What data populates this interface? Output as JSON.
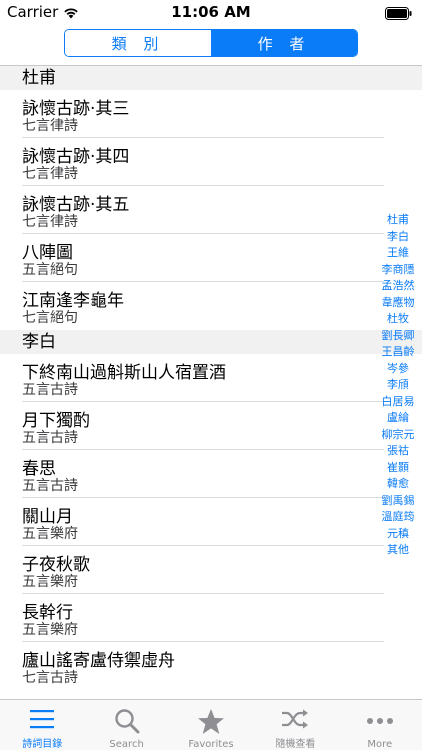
{
  "status": {
    "carrier": "Carrier",
    "time": "11:06 AM"
  },
  "segmented": {
    "left": "類 別",
    "right": "作 者",
    "selected": "right"
  },
  "sections": [
    {
      "header": "杜甫",
      "rows": [
        {
          "title": "詠懷古跡·其三",
          "subtitle": "七言律詩"
        },
        {
          "title": "詠懷古跡·其四",
          "subtitle": "七言律詩"
        },
        {
          "title": "詠懷古跡·其五",
          "subtitle": "七言律詩"
        },
        {
          "title": "八陣圖",
          "subtitle": "五言絕句"
        },
        {
          "title": "江南逢李龜年",
          "subtitle": "七言絕句"
        }
      ]
    },
    {
      "header": "李白",
      "rows": [
        {
          "title": "下終南山過斛斯山人宿置酒",
          "subtitle": "五言古詩"
        },
        {
          "title": "月下獨酌",
          "subtitle": "五言古詩"
        },
        {
          "title": "春思",
          "subtitle": "五言古詩"
        },
        {
          "title": "關山月",
          "subtitle": "五言樂府"
        },
        {
          "title": "子夜秋歌",
          "subtitle": "五言樂府"
        },
        {
          "title": "長幹行",
          "subtitle": "五言樂府"
        },
        {
          "title": "廬山謠寄盧侍禦虛舟",
          "subtitle": "七言古詩"
        }
      ]
    }
  ],
  "index": [
    "杜甫",
    "李白",
    "王維",
    "李商隱",
    "孟浩然",
    "韋應物",
    "杜牧",
    "劉長卿",
    "王昌齡",
    "岑參",
    "李頎",
    "白居易",
    "盧綸",
    "柳宗元",
    "張祜",
    "崔顥",
    "韓愈",
    "劉禹錫",
    "溫庭筠",
    "元稹",
    "其他"
  ],
  "tabs": [
    {
      "label": "詩詞目錄",
      "icon": "list-icon",
      "active": true
    },
    {
      "label": "Search",
      "icon": "search-icon",
      "active": false
    },
    {
      "label": "Favorites",
      "icon": "star-icon",
      "active": false
    },
    {
      "label": "隨機查看",
      "icon": "shuffle-icon",
      "active": false
    },
    {
      "label": "More",
      "icon": "more-icon",
      "active": false
    }
  ],
  "colors": {
    "accent": "#0b7cf7",
    "inactive": "#8e8e93",
    "section_bg": "#f1f1f2"
  }
}
